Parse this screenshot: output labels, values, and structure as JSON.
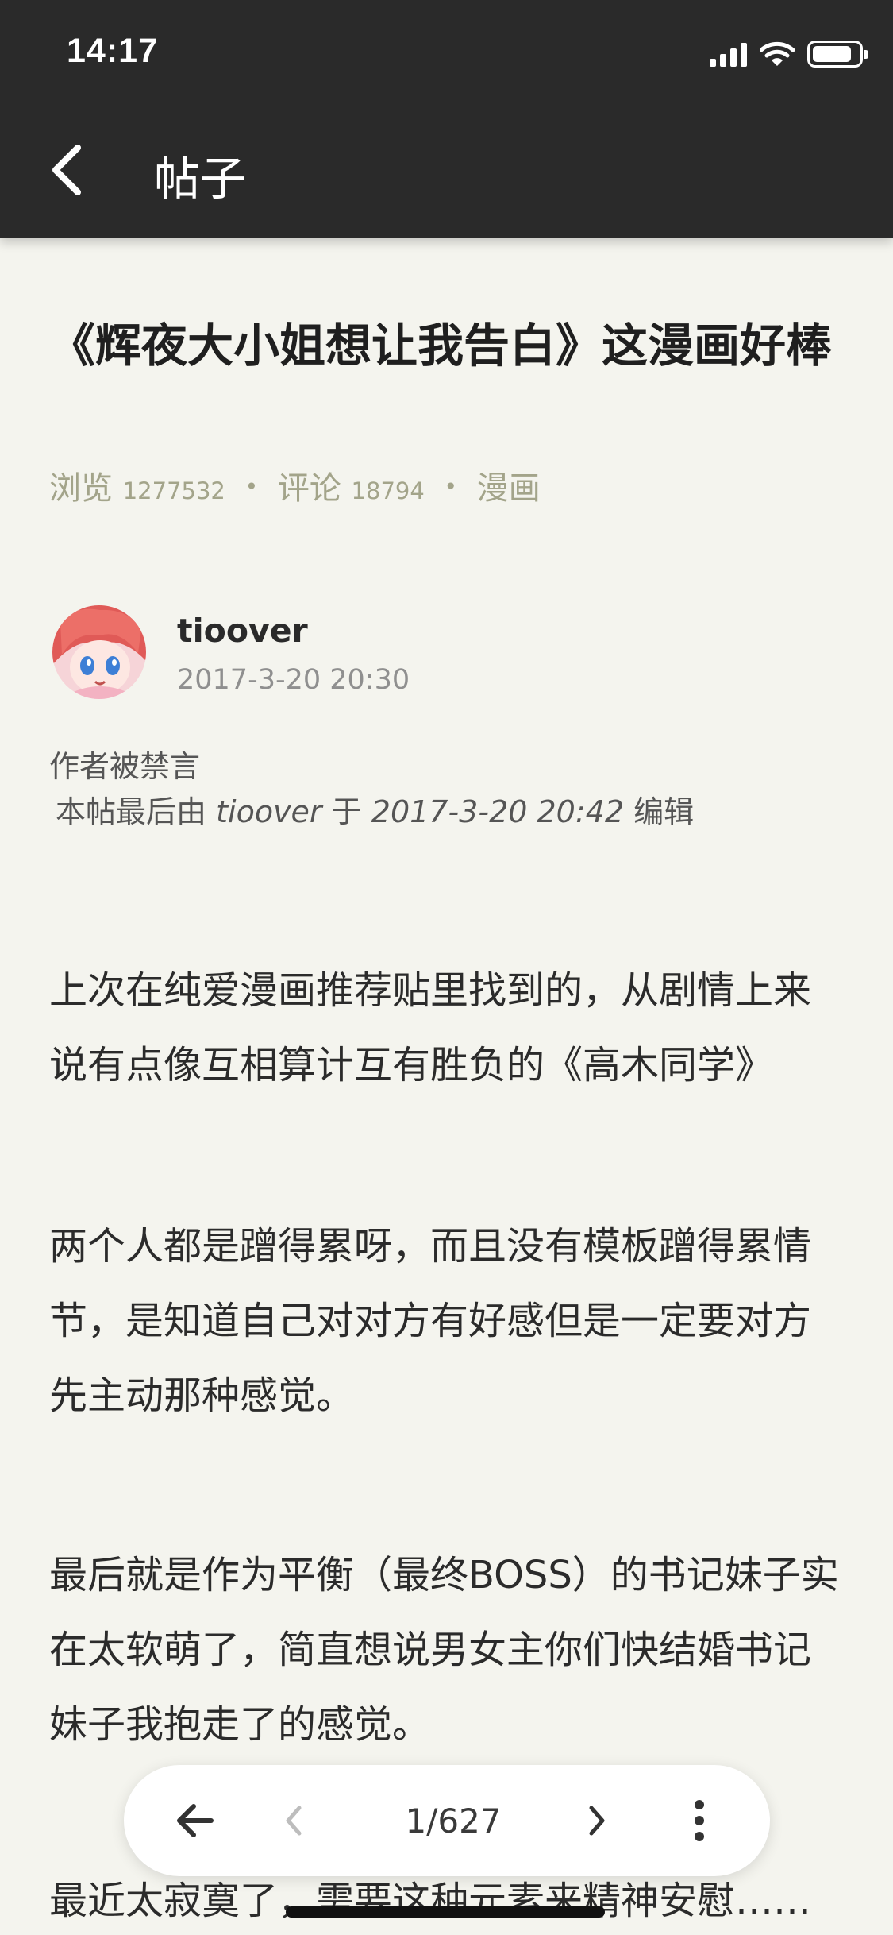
{
  "status_bar": {
    "time": "14:17"
  },
  "nav": {
    "title": "帖子"
  },
  "post": {
    "title": "《辉夜大小姐想让我告白》这漫画好棒",
    "views_label": "浏览",
    "views": "1277532",
    "comments_label": "评论",
    "comments": "18794",
    "category": "漫画",
    "author": "tioover",
    "time": "2017-3-20 20:30",
    "banned_note": "作者被禁言",
    "edit_prefix": "本帖最后由",
    "edit_user": "tioover",
    "edit_mid": "于",
    "edit_time": "2017-3-20 20:42",
    "edit_suffix": "编辑",
    "paragraphs": [
      "上次在纯爱漫画推荐贴里找到的，从剧情上来说有点像互相算计互有胜负的《高木同学》",
      "两个人都是蹭得累呀，而且没有模板蹭得累情节，是知道自己对对方有好感但是一定要对方先主动那种感觉。",
      "最后就是作为平衡（最终BOSS）的书记妹子实在太软萌了，简直想说男女主你们快结婚书记妹子我抱走了的感觉。",
      "最近太寂寞了，需要这种元素来精神安慰……"
    ]
  },
  "pager": {
    "page": "1/627"
  },
  "colors": {
    "header_bg": "#2a2a2a",
    "page_bg": "#f4f4ee",
    "meta": "#a3a48a"
  }
}
